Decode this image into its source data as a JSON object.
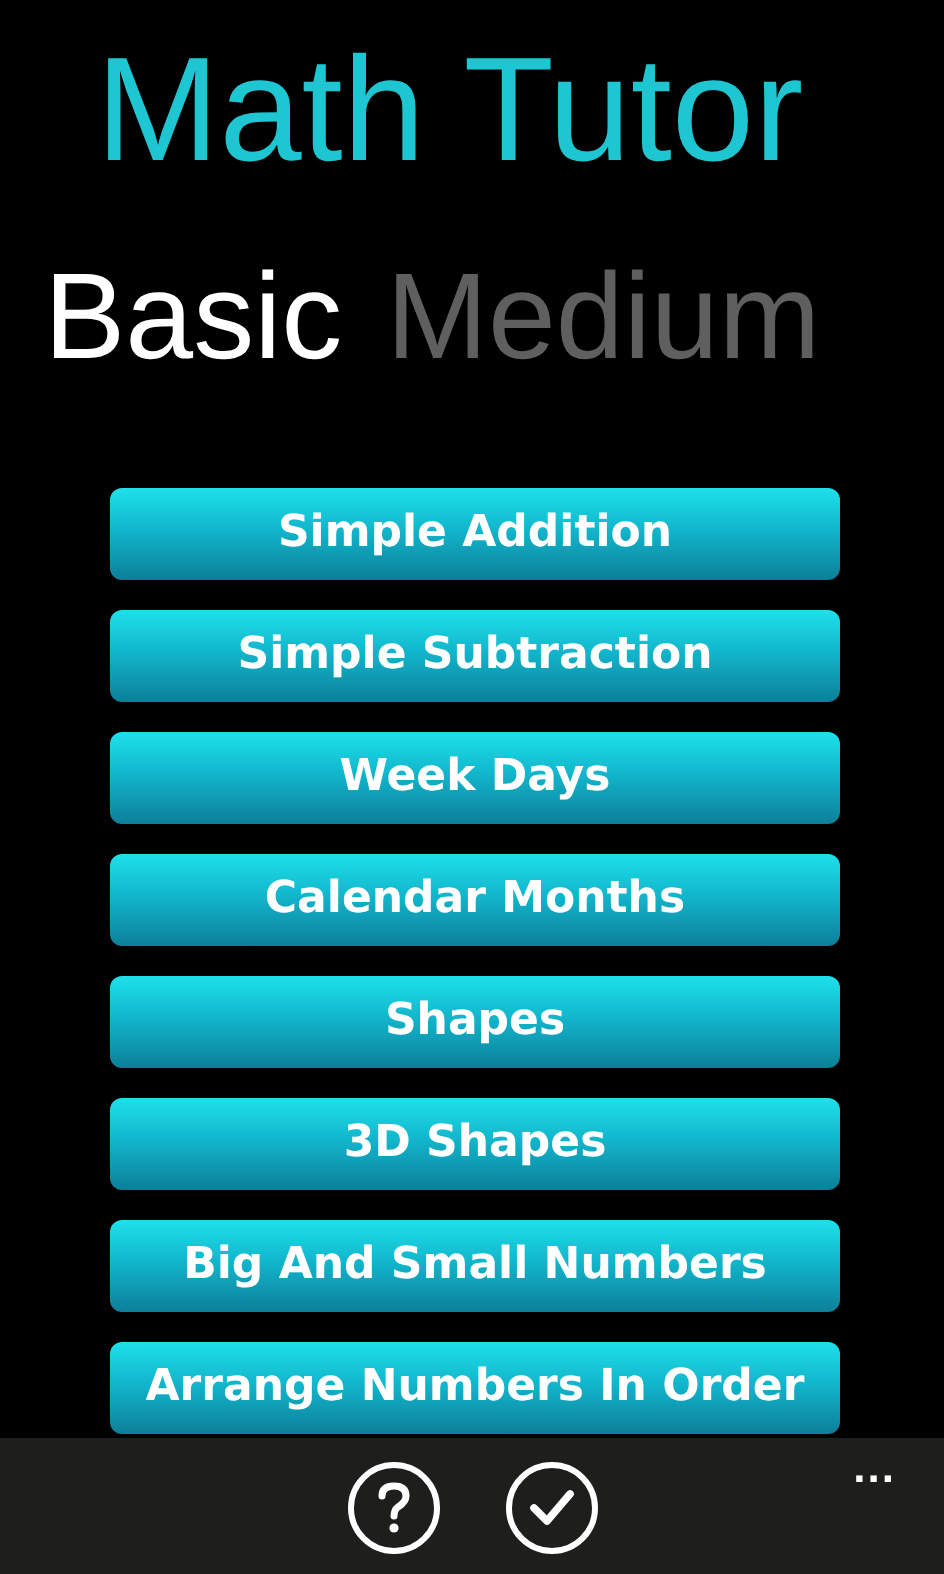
{
  "app_title": "Math Tutor",
  "pivot_tabs": [
    {
      "label": "Basic",
      "selected": true
    },
    {
      "label": "Medium",
      "selected": false
    }
  ],
  "topics": [
    "Simple Addition",
    "Simple Subtraction",
    "Week Days",
    "Calendar Months",
    "Shapes",
    "3D Shapes",
    "Big And Small Numbers",
    "Arrange Numbers In Order"
  ],
  "app_bar": {
    "buttons": [
      {
        "kind": "help"
      },
      {
        "kind": "check"
      }
    ],
    "more": "..."
  }
}
